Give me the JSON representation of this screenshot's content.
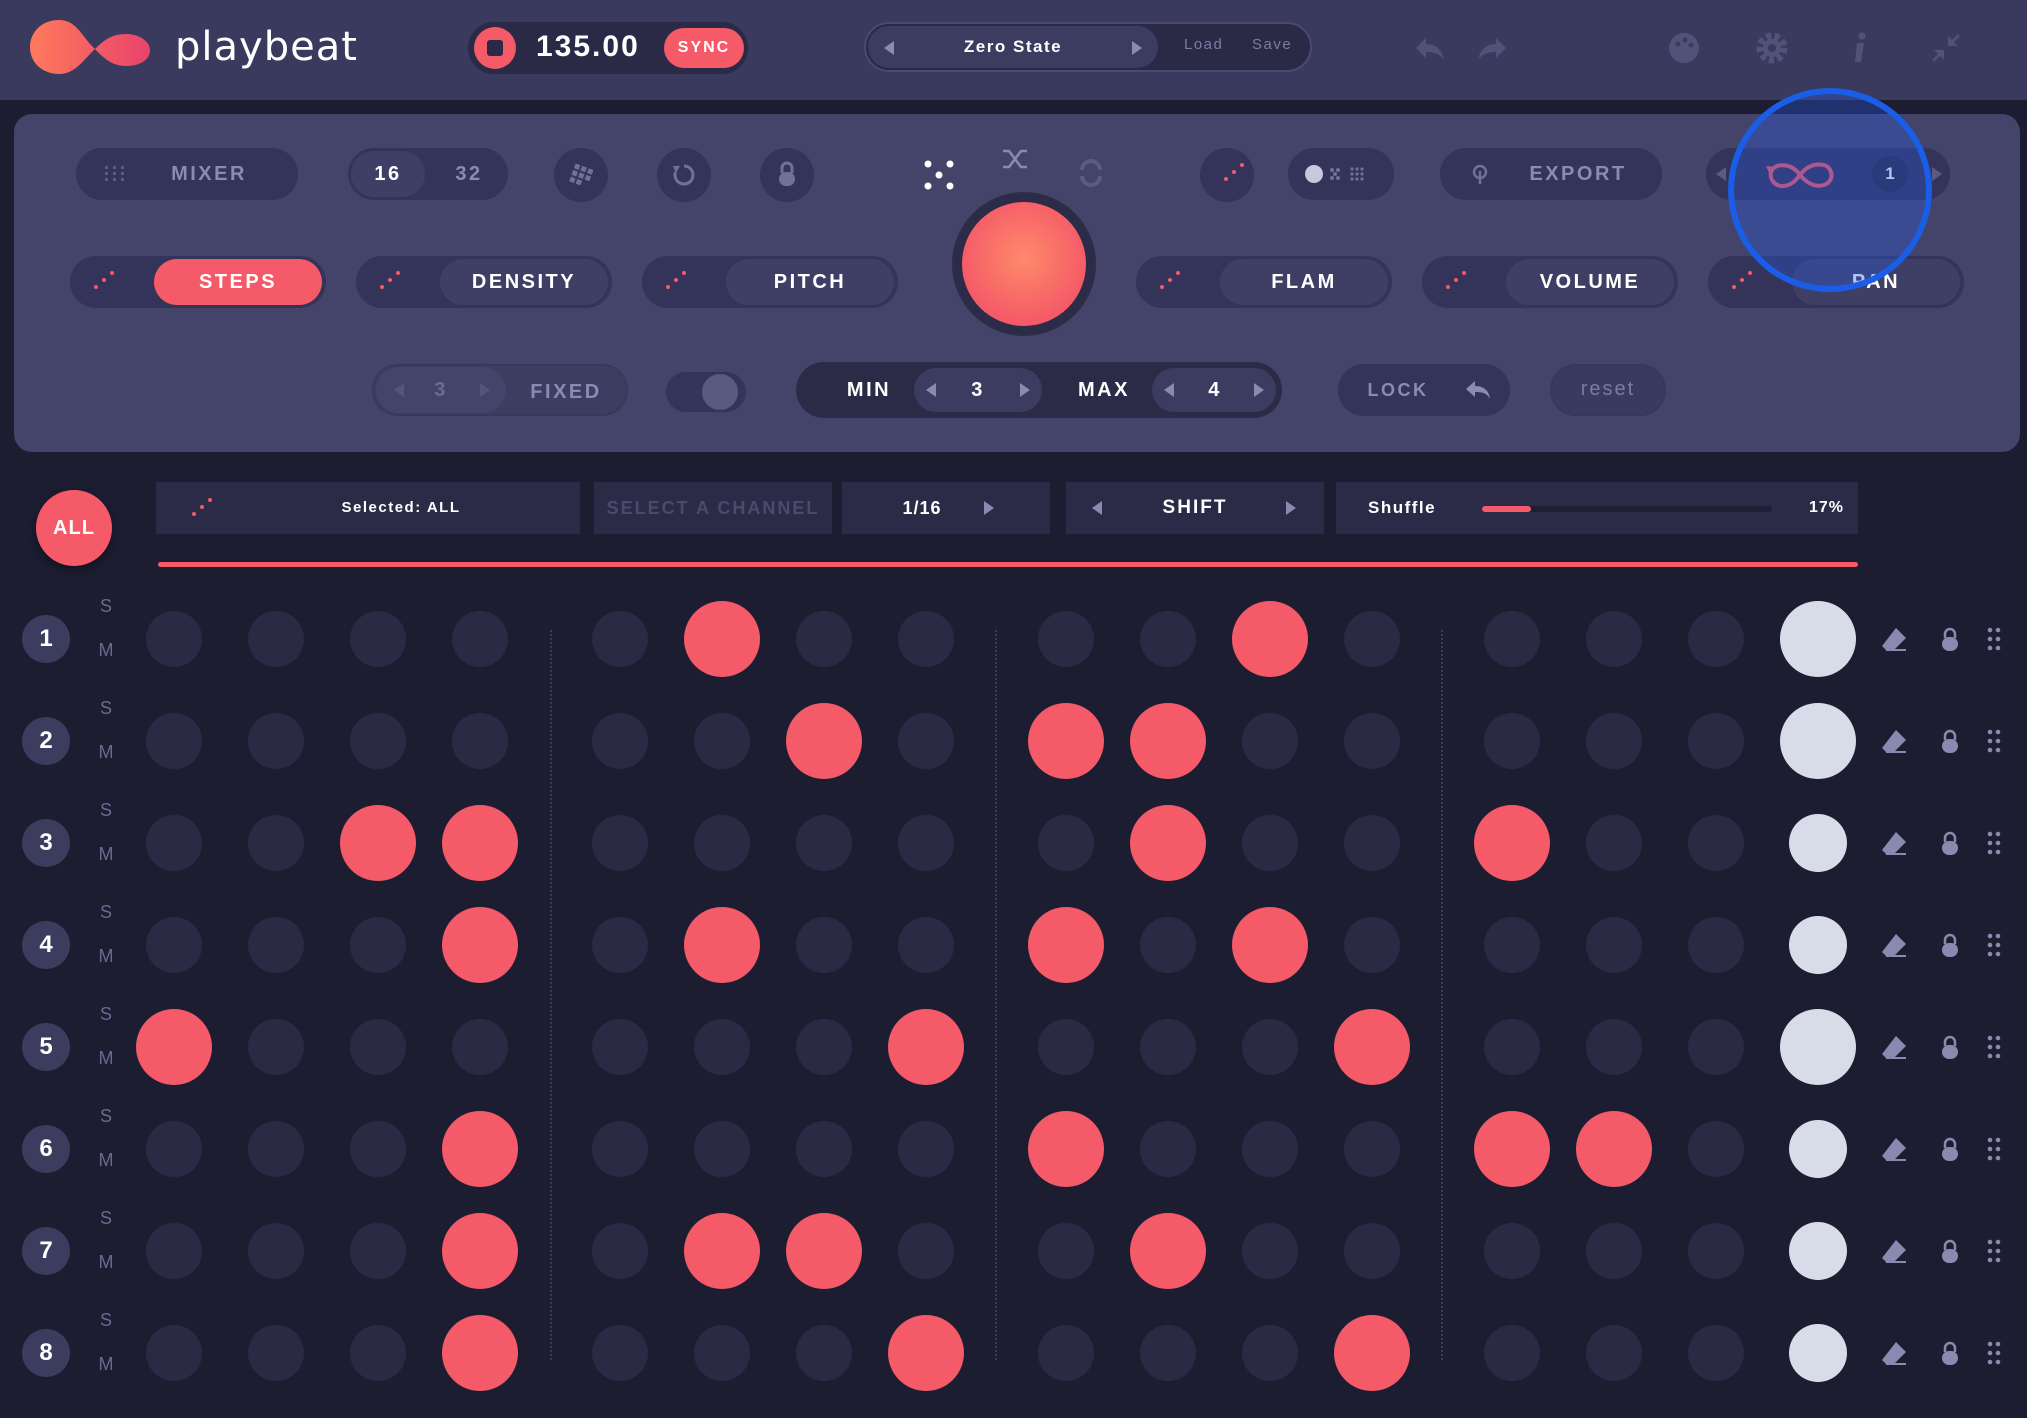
{
  "app": {
    "name": "playbeat"
  },
  "transport": {
    "bpm": "135.00",
    "sync_label": "SYNC"
  },
  "preset": {
    "name": "Zero State",
    "load_label": "Load",
    "save_label": "Save"
  },
  "panel": {
    "mixer_label": "MIXER",
    "steps_16": "16",
    "steps_32": "32",
    "export_label": "EXPORT",
    "loop_count": "1",
    "params": [
      "STEPS",
      "DENSITY",
      "PITCH",
      "FLAM",
      "VOLUME",
      "PAN"
    ],
    "active_param": "STEPS",
    "fixed_value": "3",
    "fixed_label": "FIXED",
    "min_label": "MIN",
    "min_value": "3",
    "max_label": "MAX",
    "max_value": "4",
    "lock_label": "LOCK",
    "reset_label": "reset"
  },
  "toolbar": {
    "all_label": "ALL",
    "selected_label": "Selected: ALL",
    "channel_placeholder": "SELECT A CHANNEL",
    "resolution": "1/16",
    "shift_label": "SHIFT",
    "shuffle_label": "Shuffle",
    "shuffle_value": "17%",
    "shuffle_fraction": 0.17
  },
  "colors": {
    "accent": "#f45a67",
    "panel": "#44446b",
    "background": "#1d1d32",
    "highlight": "#1a5ee8"
  },
  "grid": {
    "solo_label": "S",
    "mute_label": "M",
    "channels": [
      {
        "number": "1",
        "steps": [
          0,
          0,
          0,
          0,
          0,
          1,
          0,
          0,
          0,
          0,
          1,
          0,
          0,
          0,
          0
        ],
        "velocity": "large"
      },
      {
        "number": "2",
        "steps": [
          0,
          0,
          0,
          0,
          0,
          0,
          1,
          0,
          1,
          1,
          0,
          0,
          0,
          0,
          0
        ],
        "velocity": "large"
      },
      {
        "number": "3",
        "steps": [
          0,
          0,
          1,
          1,
          0,
          0,
          0,
          0,
          0,
          1,
          0,
          0,
          1,
          0,
          0
        ],
        "velocity": "small"
      },
      {
        "number": "4",
        "steps": [
          0,
          0,
          0,
          1,
          0,
          1,
          0,
          0,
          1,
          0,
          1,
          0,
          0,
          0,
          0
        ],
        "velocity": "small"
      },
      {
        "number": "5",
        "steps": [
          1,
          0,
          0,
          0,
          0,
          0,
          0,
          1,
          0,
          0,
          0,
          1,
          0,
          0,
          0
        ],
        "velocity": "large"
      },
      {
        "number": "6",
        "steps": [
          0,
          0,
          0,
          1,
          0,
          0,
          0,
          0,
          1,
          0,
          0,
          0,
          1,
          1,
          0
        ],
        "velocity": "small"
      },
      {
        "number": "7",
        "steps": [
          0,
          0,
          0,
          1,
          0,
          1,
          1,
          0,
          0,
          1,
          0,
          0,
          0,
          0,
          0
        ],
        "velocity": "small"
      },
      {
        "number": "8",
        "steps": [
          0,
          0,
          0,
          1,
          0,
          0,
          0,
          1,
          0,
          0,
          0,
          1,
          0,
          0,
          0
        ],
        "velocity": "small"
      }
    ]
  }
}
